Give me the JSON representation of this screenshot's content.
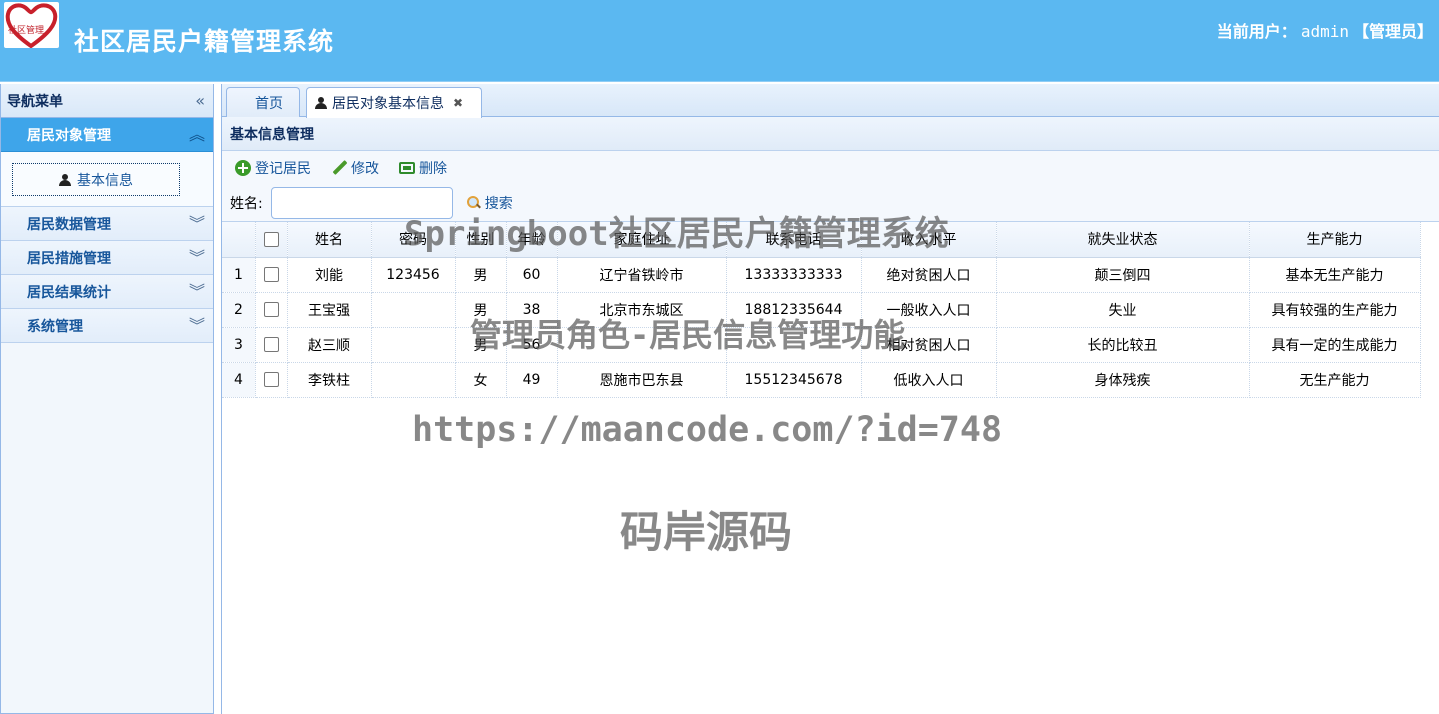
{
  "header": {
    "logo_text": "社区管理",
    "title": "社区居民户籍管理系统",
    "user_prefix": "当前用户：",
    "username": "admin",
    "role": "【管理员】"
  },
  "sidebar": {
    "title": "导航菜单",
    "menus": [
      {
        "label": "居民对象管理",
        "expanded": true,
        "items": [
          {
            "label": "基本信息",
            "icon": "person-icon"
          }
        ]
      },
      {
        "label": "居民数据管理",
        "expanded": false
      },
      {
        "label": "居民措施管理",
        "expanded": false
      },
      {
        "label": "居民结果统计",
        "expanded": false
      },
      {
        "label": "系统管理",
        "expanded": false
      }
    ]
  },
  "tabs": [
    {
      "label": "首页",
      "active": false
    },
    {
      "label": "居民对象基本信息",
      "active": true,
      "closable": true
    }
  ],
  "panel": {
    "title": "基本信息管理",
    "toolbar": {
      "add_label": "登记居民",
      "edit_label": "修改",
      "delete_label": "删除"
    },
    "search": {
      "name_label": "姓名:",
      "name_value": "",
      "button_label": "搜索"
    }
  },
  "table": {
    "columns": [
      "姓名",
      "密码",
      "性别",
      "年龄",
      "家庭住址",
      "联系电话",
      "收入水平",
      "就失业状态",
      "生产能力"
    ],
    "rows": [
      {
        "num": "1",
        "cells": [
          "刘能",
          "123456",
          "男",
          "60",
          "辽宁省铁岭市",
          "13333333333",
          "绝对贫困人口",
          "颠三倒四",
          "基本无生产能力"
        ]
      },
      {
        "num": "2",
        "cells": [
          "王宝强",
          "",
          "男",
          "38",
          "北京市东城区",
          "18812335644",
          "一般收入人口",
          "失业",
          "具有较强的生产能力"
        ]
      },
      {
        "num": "3",
        "cells": [
          "赵三顺",
          "",
          "男",
          "56",
          "",
          "",
          "相对贫困人口",
          "长的比较丑",
          "具有一定的生成能力"
        ]
      },
      {
        "num": "4",
        "cells": [
          "李铁柱",
          "",
          "女",
          "49",
          "恩施市巴东县",
          "15512345678",
          "低收入人口",
          "身体残疾",
          "无生产能力"
        ]
      }
    ]
  },
  "watermarks": {
    "line1": "Springboot社区居民户籍管理系统",
    "line2": "管理员角色-居民信息管理功能",
    "line3": "https://maancode.com/?id=748",
    "line4": "码岸源码"
  },
  "colors": {
    "header_bg": "#5bb8f1",
    "active_menu": "#3ea5ea",
    "border": "#95b8e7",
    "link": "#17569b"
  }
}
